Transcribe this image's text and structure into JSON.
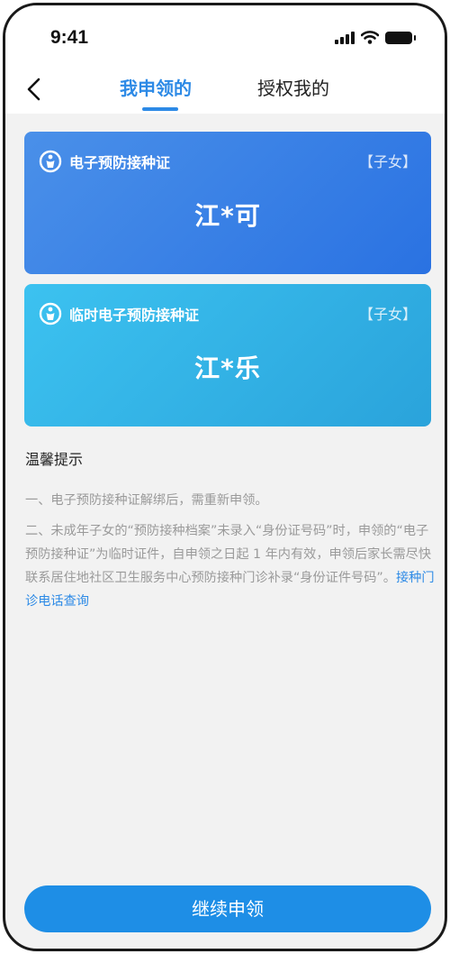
{
  "status_bar": {
    "time": "9:41"
  },
  "nav": {
    "tabs": [
      {
        "label": "我申领的",
        "active": true
      },
      {
        "label": "授权我的",
        "active": false
      }
    ]
  },
  "cards": [
    {
      "title": "电子预防接种证",
      "tag": "【子女】",
      "name": "江*可"
    },
    {
      "title": "临时电子预防接种证",
      "tag": "【子女】",
      "name": "江*乐"
    }
  ],
  "tips": {
    "title": "温馨提示",
    "item1": "一、电子预防接种证解绑后，需重新申领。",
    "item2": "二、未成年子女的“预防接种档案”未录入“身份证号码”时，申领的“电子预防接种证”为临时证件，自申领之日起 1 年内有效，申领后家长需尽快联系居住地社区卫生服务中心预防接种门诊补录“身份证件号码”。",
    "link": "接种门诊电话查询"
  },
  "button": {
    "label": "继续申领"
  },
  "colors": {
    "accent": "#2d8ae6",
    "card1": "#3a82e6",
    "card2": "#33b3e6",
    "button": "#1e8ee6"
  }
}
